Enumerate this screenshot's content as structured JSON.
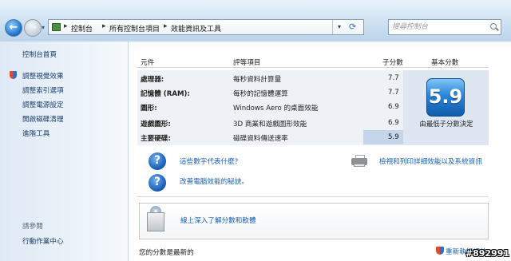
{
  "address_bar": {
    "breadcrumb": [
      "控制台",
      "所有控制台項目",
      "效能資訊及工具"
    ]
  },
  "search": {
    "placeholder": "搜尋控制台"
  },
  "sidebar": {
    "items": [
      {
        "label": "控制台首頁"
      },
      {
        "label": "調整視覺效果"
      },
      {
        "label": "調整索引選項"
      },
      {
        "label": "調整電源設定"
      },
      {
        "label": "開啟磁碟清理"
      },
      {
        "label": "進階工具"
      }
    ],
    "see_also_heading": "請參閱",
    "see_also_items": [
      {
        "label": "行動作業中心"
      }
    ]
  },
  "scores_table": {
    "headers": {
      "component": "元件",
      "rated": "評等項目",
      "subscore": "子分數",
      "base": "基本分數"
    },
    "rows": [
      {
        "component": "處理器:",
        "rated": "每秒資料計算量",
        "subscore": "7.7"
      },
      {
        "component": "記憶體 (RAM):",
        "rated": "每秒的記憶體運算",
        "subscore": "7.7"
      },
      {
        "component": "圖形:",
        "rated": "Windows Aero 的桌面效能",
        "subscore": "6.9"
      },
      {
        "component": "遊戲圖形:",
        "rated": "3D 商業和遊戲圖形效能",
        "subscore": "6.9"
      },
      {
        "component": "主要硬碟:",
        "rated": "磁碟資料傳送速率",
        "subscore": "5.9"
      }
    ],
    "base_score": "5.9",
    "base_note": "由最低子分數決定"
  },
  "links": {
    "what_numbers": "這些數字代表什麼?",
    "print_details": "檢視和列印詳細效能以及系統資訊",
    "improve_tips": "改善電腦效能的秘訣。",
    "online_help": "線上深入了解分數和軟體"
  },
  "status": {
    "current": "您的分數是最新的",
    "rerun": "重新執行評估"
  },
  "watermark": "#892991"
}
